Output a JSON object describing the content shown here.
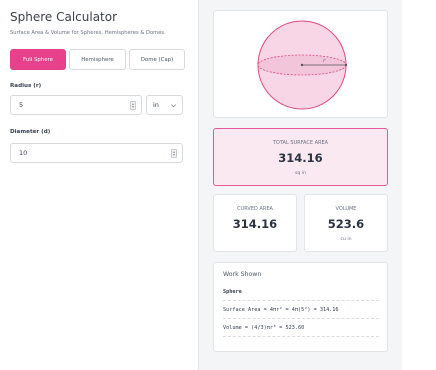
{
  "header": {
    "title": "Sphere Calculator",
    "subtitle": "Surface Area & Volume for Spheres, Hemispheres & Domes."
  },
  "tabs": [
    {
      "label": "Full Sphere",
      "active": true
    },
    {
      "label": "Hemisphere",
      "active": false
    },
    {
      "label": "Dome (Cap)",
      "active": false
    }
  ],
  "radius": {
    "label": "Radius (r)",
    "value": "5",
    "unit": "in"
  },
  "diameter": {
    "label": "Diameter (d)",
    "value": "10"
  },
  "diagram": {
    "radius_label": "r"
  },
  "results": {
    "total_surface_area": {
      "label": "TOTAL SURFACE AREA",
      "value": "314.16",
      "unit": "sq in"
    },
    "curved_area": {
      "label": "CURVED AREA",
      "value": "314.16"
    },
    "volume": {
      "label": "VOLUME",
      "value": "523.6",
      "unit": "cu in"
    }
  },
  "work": {
    "title": "Work Shown",
    "shape": "Sphere",
    "line1": "Surface Area = 4πr² = 4π(5²) = 314.16",
    "line2": "Volume = (4/3)πr³ = 523.60"
  },
  "colors": {
    "accent": "#e8418c",
    "sphere_fill": "#f9d6e6",
    "sphere_stroke": "#e2497f"
  }
}
